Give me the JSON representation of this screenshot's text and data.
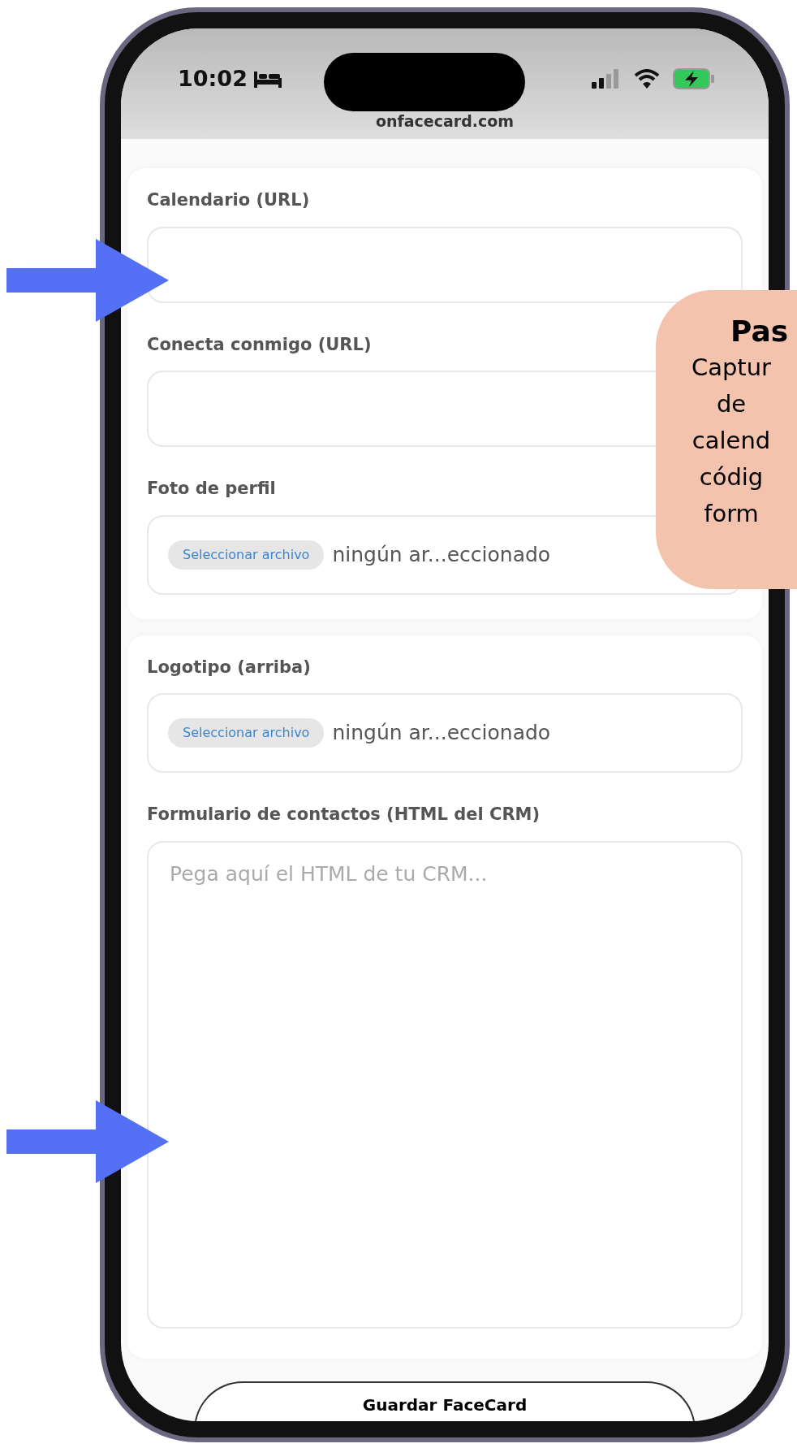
{
  "status_bar": {
    "time": "10:02",
    "url": "onfacecard.com"
  },
  "sections": [
    {
      "fields": [
        {
          "kind": "text",
          "label": "Calendario (URL)"
        },
        {
          "kind": "text",
          "label": "Conecta conmigo (URL)"
        },
        {
          "kind": "file",
          "label": "Foto de perfil",
          "button": "Seleccionar archivo",
          "file_status": "ningún ar...eccionado"
        }
      ]
    },
    {
      "fields": [
        {
          "kind": "file",
          "label": "Logotipo (arriba)",
          "button": "Seleccionar archivo",
          "file_status": "ningún ar...eccionado"
        },
        {
          "kind": "textarea",
          "label": "Formulario de contactos (HTML del CRM)",
          "placeholder": "Pega aquí el HTML de tu CRM..."
        }
      ]
    }
  ],
  "save_button": "Guardar FaceCard",
  "callout": {
    "title": "Pas",
    "lines": [
      "Captur",
      "de",
      "calend",
      "códig",
      "form"
    ]
  },
  "arrows": [
    {
      "kind": "right"
    },
    {
      "kind": "right"
    }
  ]
}
